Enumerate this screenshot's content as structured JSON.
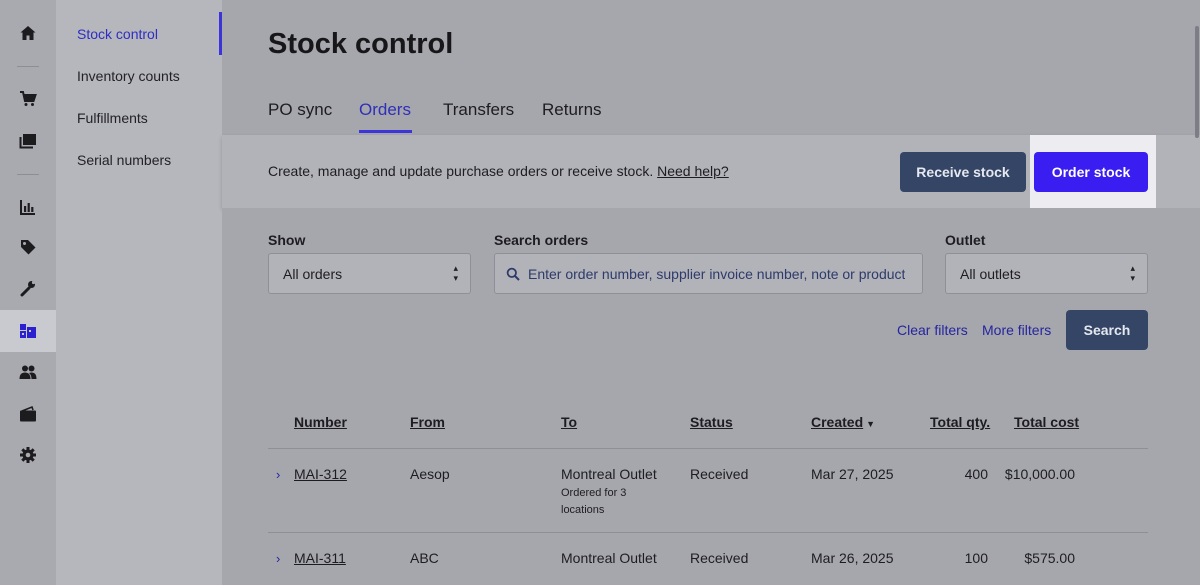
{
  "rail": {
    "items": [
      {
        "icon": "home-icon"
      },
      {
        "icon": "cart-icon"
      },
      {
        "icon": "register-icon"
      },
      {
        "icon": "reports-icon"
      },
      {
        "icon": "tag-icon"
      },
      {
        "icon": "wrench-icon"
      },
      {
        "icon": "inventory-icon",
        "active": true
      },
      {
        "icon": "customers-icon"
      },
      {
        "icon": "wallet-icon"
      },
      {
        "icon": "gear-icon"
      }
    ]
  },
  "subnav": {
    "items": [
      {
        "label": "Stock control",
        "active": true
      },
      {
        "label": "Inventory counts"
      },
      {
        "label": "Fulfillments"
      },
      {
        "label": "Serial numbers"
      }
    ]
  },
  "page": {
    "title": "Stock control",
    "tabs": [
      {
        "label": "PO sync"
      },
      {
        "label": "Orders",
        "active": true
      },
      {
        "label": "Transfers"
      },
      {
        "label": "Returns"
      }
    ]
  },
  "info": {
    "text": "Create, manage and update purchase orders or receive stock.",
    "help_link": "Need help?",
    "receive_label": "Receive stock",
    "order_label": "Order stock"
  },
  "filters": {
    "show_label": "Show",
    "show_value": "All orders",
    "search_label": "Search orders",
    "search_placeholder": "Enter order number, supplier invoice number, note or product",
    "outlet_label": "Outlet",
    "outlet_value": "All outlets",
    "clear_label": "Clear filters",
    "more_label": "More filters",
    "search_button": "Search"
  },
  "table": {
    "headers": {
      "number": "Number",
      "from": "From",
      "to": "To",
      "status": "Status",
      "created": "Created",
      "qty": "Total qty.",
      "cost": "Total cost"
    },
    "rows": [
      {
        "number": "MAI-312",
        "from": "Aesop",
        "to": "Montreal Outlet",
        "to_note_1": "Ordered for 3",
        "to_note_2": "locations",
        "status": "Received",
        "created": "Mar 27, 2025",
        "qty": "400",
        "cost": "$10,000.00"
      },
      {
        "number": "MAI-311",
        "from": "ABC",
        "to": "Montreal Outlet",
        "status": "Received",
        "created": "Mar 26, 2025",
        "qty": "100",
        "cost": "$575.00"
      }
    ]
  },
  "colors": {
    "accent": "#3a1df0",
    "secondary_button": "#344566",
    "link": "#26269e"
  }
}
